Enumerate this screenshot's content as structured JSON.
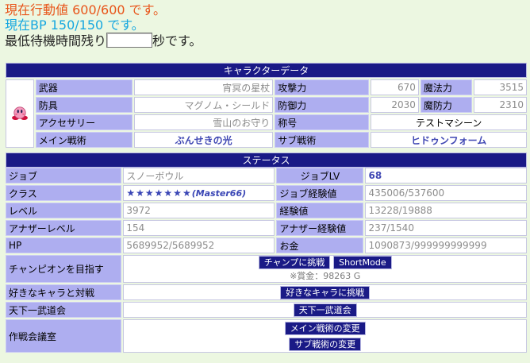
{
  "header": {
    "action_value": "現在行動値 600/600 です。",
    "bp": "現在BP 150/150 です。",
    "wait_prefix": "最低待機時間残り",
    "wait_suffix": "秒です。"
  },
  "character": {
    "title": "キャラクターデータ",
    "avatar": "kirby-sprite-icon",
    "weapon_label": "武器",
    "weapon": "宵冥の星杖",
    "attack_label": "攻撃力",
    "attack": "670",
    "magic_label": "魔法力",
    "magic": "3515",
    "armor_label": "防具",
    "armor": "マグノム・シールド",
    "defense_label": "防御力",
    "defense": "2030",
    "mdef_label": "魔防力",
    "mdef": "2310",
    "accessory_label": "アクセサリー",
    "accessory": "雪山のお守り",
    "title_label": "称号",
    "title_value": "テストマシーン",
    "main_tactic_label": "メイン戦術",
    "main_tactic": "ぶんせきの光",
    "sub_tactic_label": "サブ戦術",
    "sub_tactic": "ヒドゥンフォーム"
  },
  "status": {
    "title": "ステータス",
    "job_label": "ジョブ",
    "job": "スノーボウル",
    "joblv_label": "ジョブLV",
    "joblv": "68",
    "class_label": "クラス",
    "class_stars": "★★★★★★★",
    "class_rank": "(Master66)",
    "jobexp_label": "ジョブ経験値",
    "jobexp": "435006/537600",
    "level_label": "レベル",
    "level": "3972",
    "exp_label": "経験値",
    "exp": "13228/19888",
    "another_level_label": "アナザーレベル",
    "another_level": "154",
    "another_exp_label": "アナザー経験値",
    "another_exp": "237/1540",
    "hp_label": "HP",
    "hp": "5689952/5689952",
    "money_label": "お金",
    "money": "1090873/999999999999"
  },
  "actions": {
    "champion_label": "チャンピオンを目指す",
    "champion_button": "チャンプに挑戦",
    "short_mode_button": "ShortMode",
    "prize_text": "※賞金：98263 G",
    "fav_label": "好きなキャラと対戦",
    "fav_button": "好きなキャラに挑戦",
    "tenka_label": "天下一武道会",
    "tenka_button": "天下一武道会",
    "strategy_label": "作戦会議室",
    "main_change_button": "メイン戦術の変更",
    "sub_change_button": "サブ戦術の変更"
  }
}
